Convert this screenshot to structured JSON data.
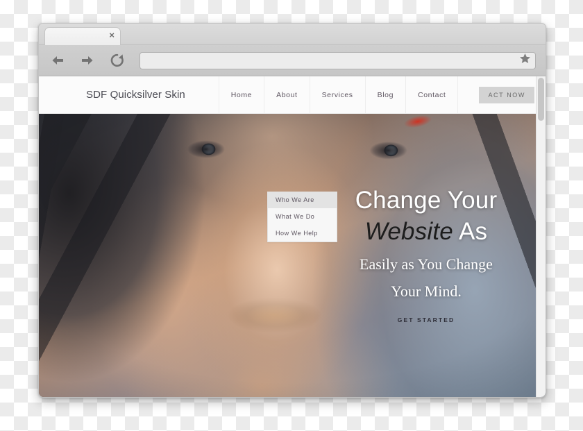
{
  "browser": {
    "tab": {
      "title": "",
      "close_label": "×"
    },
    "toolbar": {
      "back_icon": "back-arrow-icon",
      "forward_icon": "forward-arrow-icon",
      "reload_icon": "reload-icon",
      "address_value": "",
      "address_placeholder": "",
      "bookmark_icon": "star-icon"
    }
  },
  "site": {
    "logo": "SDF Quicksilver Skin",
    "nav": [
      {
        "label": "Home"
      },
      {
        "label": "About"
      },
      {
        "label": "Services"
      },
      {
        "label": "Blog"
      },
      {
        "label": "Contact"
      }
    ],
    "cta": {
      "label": "ACT NOW"
    },
    "dropdown": {
      "parent": "About",
      "items": [
        {
          "label": "Who We Are",
          "active": true
        },
        {
          "label": "What We Do",
          "active": false
        },
        {
          "label": "How We Help",
          "active": false
        }
      ]
    },
    "hero": {
      "line1": "Change Your",
      "line2_emphasis": "Website",
      "line2_rest": "As",
      "subline1": "Easily as You Change",
      "subline2": "Your Mind.",
      "button": "GET STARTED"
    }
  },
  "colors": {
    "chrome_toolbar": "#c9c9c9",
    "tab_active": "#f2f2f2",
    "site_header_bg": "#fbfbfb",
    "nav_text": "#5d5560",
    "cta_bg": "#d3d3d3",
    "cta_text": "#6a6a6a",
    "dropdown_bg": "#f7f7f7",
    "dropdown_active_bg": "#e3e3e3",
    "hero_heading": "#ffffff",
    "hero_emphasis": "#1d1d1d",
    "getstarted_text": "#2e2e38"
  }
}
